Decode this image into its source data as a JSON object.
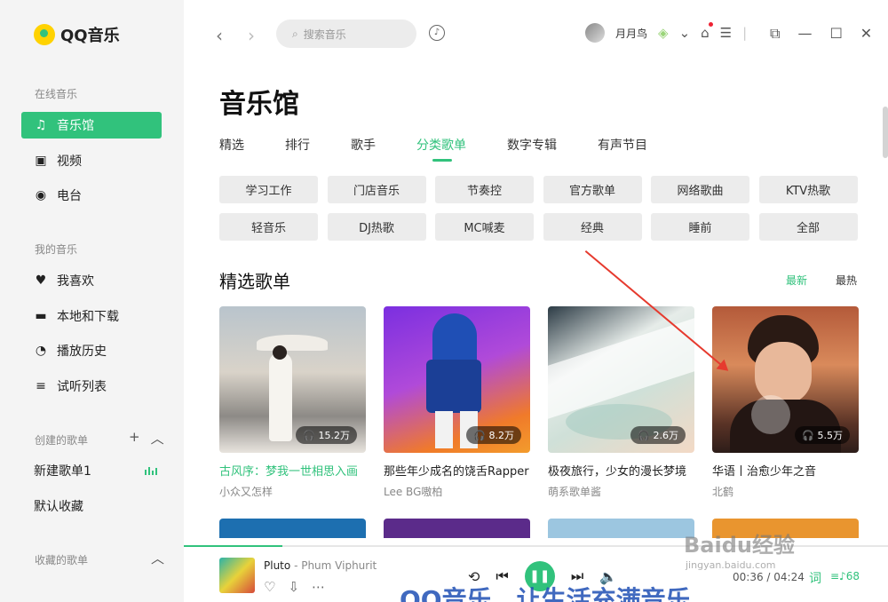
{
  "app": {
    "name": "QQ音乐"
  },
  "sidebar": {
    "online_label": "在线音乐",
    "online_items": [
      {
        "label": "音乐馆",
        "icon": "music-note-icon",
        "active": true
      },
      {
        "label": "视频",
        "icon": "video-icon"
      },
      {
        "label": "电台",
        "icon": "radio-icon"
      }
    ],
    "my_label": "我的音乐",
    "my_items": [
      {
        "label": "我喜欢",
        "icon": "heart-icon"
      },
      {
        "label": "本地和下载",
        "icon": "monitor-icon"
      },
      {
        "label": "播放历史",
        "icon": "clock-icon"
      },
      {
        "label": "试听列表",
        "icon": "playlist-icon"
      }
    ],
    "created_label": "创建的歌单",
    "created_items": [
      "新建歌单1",
      "默认收藏"
    ],
    "collected_label": "收藏的歌单"
  },
  "topbar": {
    "search_placeholder": "搜索音乐",
    "username": "月月鸟"
  },
  "main": {
    "title": "音乐馆",
    "tabs": [
      "精选",
      "排行",
      "歌手",
      "分类歌单",
      "数字专辑",
      "有声节目"
    ],
    "active_tab": "分类歌单",
    "tags": [
      "学习工作",
      "门店音乐",
      "节奏控",
      "官方歌单",
      "网络歌曲",
      "KTV热歌",
      "轻音乐",
      "DJ热歌",
      "MC喊麦",
      "经典",
      "睡前",
      "全部"
    ],
    "section_title": "精选歌单",
    "sort_new": "最新",
    "sort_hot": "最热",
    "playlists": [
      {
        "title": "古风序：梦我一世相思入画",
        "author": "小众又怎样",
        "plays": "15.2万",
        "highlight": true
      },
      {
        "title": "那些年少成名的饶舌Rapper",
        "author": "Lee BG嗷柏",
        "plays": "8.2万"
      },
      {
        "title": "极夜旅行，少女的漫长梦境",
        "author": "萌系歌单酱",
        "plays": "2.6万"
      },
      {
        "title": "华语丨治愈少年之音",
        "author": "北鹤",
        "plays": "5.5万"
      }
    ]
  },
  "player": {
    "song": "Pluto",
    "artist": "Phum Viphurit",
    "time": "00:36 / 04:24",
    "progress_fraction": 0.14,
    "lyric_label": "词",
    "queue_count": "68"
  },
  "overlay": {
    "watermark": "QQ音乐，让生活充满音乐",
    "baidu": "Baidu经验",
    "baidu_url": "jingyan.baidu.com"
  },
  "colors": {
    "accent": "#31c27c",
    "annotation_arrow": "#e63a2e"
  }
}
